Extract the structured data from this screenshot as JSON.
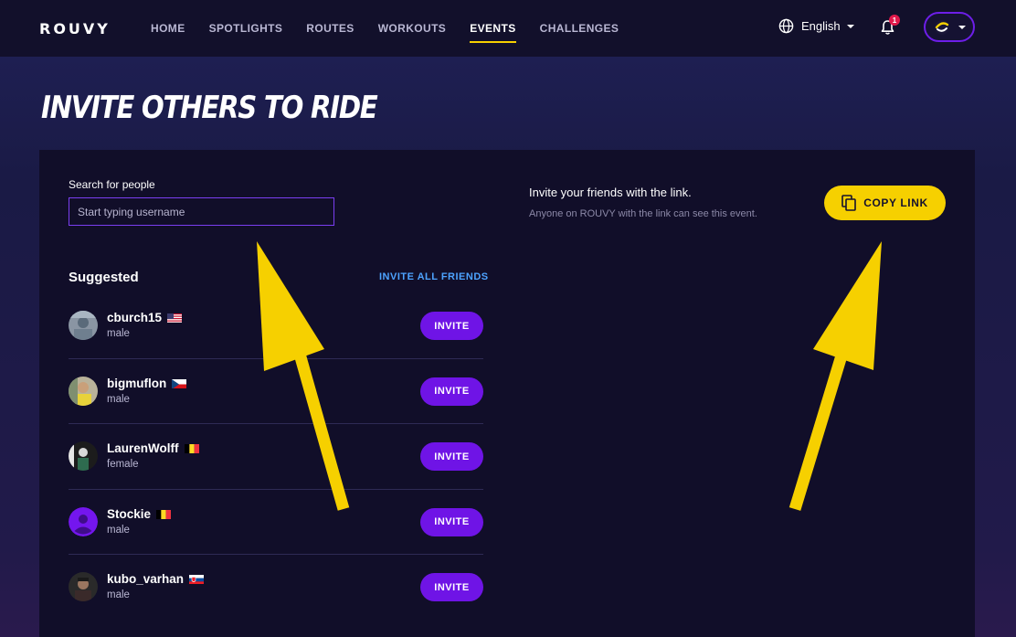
{
  "nav": {
    "logo": "ROUVY",
    "links": [
      {
        "label": "HOME",
        "active": false
      },
      {
        "label": "SPOTLIGHTS",
        "active": false
      },
      {
        "label": "ROUTES",
        "active": false
      },
      {
        "label": "WORKOUTS",
        "active": false
      },
      {
        "label": "EVENTS",
        "active": true
      },
      {
        "label": "CHALLENGES",
        "active": false
      }
    ],
    "language": "English",
    "notification_count": "1",
    "accent_color": "#f6d000"
  },
  "page": {
    "title": "INVITE OTHERS TO RIDE"
  },
  "search": {
    "label": "Search for people",
    "placeholder": "Start typing username",
    "value": ""
  },
  "suggested": {
    "title": "Suggested",
    "invite_all_label": "INVITE ALL FRIENDS",
    "invite_button_label": "INVITE",
    "people": [
      {
        "username": "cburch15",
        "gender": "male",
        "flag": "us",
        "avatar": "photo"
      },
      {
        "username": "bigmuflon",
        "gender": "male",
        "flag": "cz",
        "avatar": "photo"
      },
      {
        "username": "LaurenWolff",
        "gender": "female",
        "flag": "be",
        "avatar": "photo"
      },
      {
        "username": "Stockie",
        "gender": "male",
        "flag": "be",
        "avatar": "default"
      },
      {
        "username": "kubo_varhan",
        "gender": "male",
        "flag": "sk",
        "avatar": "photo"
      }
    ]
  },
  "share_link": {
    "title": "Invite your friends with the link.",
    "subtitle": "Anyone on ROUVY with the link can see this event.",
    "copy_label": "COPY LINK"
  },
  "colors": {
    "primary_button": "#6f14e6",
    "copy_button": "#f6d000",
    "link_blue": "#4da3ff",
    "annotation_arrow": "#f6d000"
  }
}
